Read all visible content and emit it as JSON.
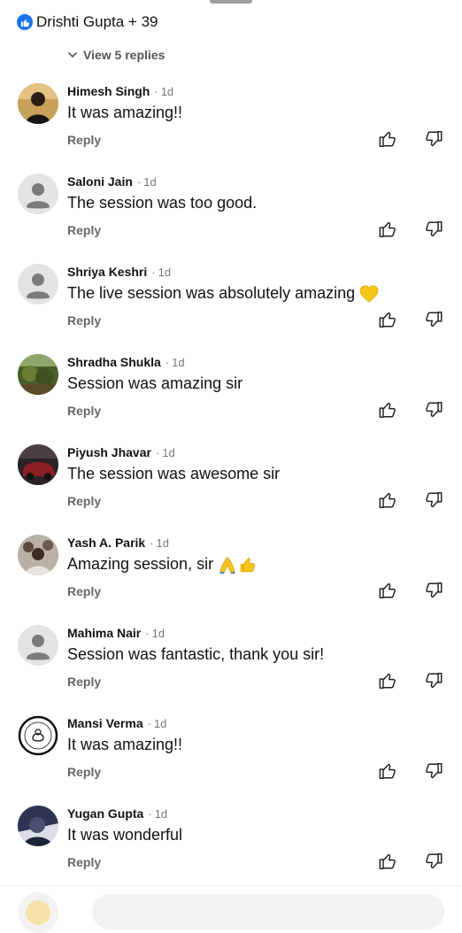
{
  "header": {
    "reactions_text": "Drishti Gupta + 39",
    "view_replies": "View 5 replies"
  },
  "comments": [
    {
      "author": "Himesh Singh",
      "time": "1d",
      "text": "It was amazing!!",
      "reply": "Reply"
    },
    {
      "author": "Saloni Jain",
      "time": "1d",
      "text": "The session was too good.",
      "reply": "Reply"
    },
    {
      "author": "Shriya Keshri",
      "time": "1d",
      "text": "The live session was absolutely amazing",
      "reply": "Reply"
    },
    {
      "author": "Shradha Shukla",
      "time": "1d",
      "text": "Session was amazing sir",
      "reply": "Reply"
    },
    {
      "author": "Piyush Jhavar",
      "time": "1d",
      "text": "The session was awesome sir",
      "reply": "Reply"
    },
    {
      "author": "Yash A. Parik",
      "time": "1d",
      "text": "Amazing session, sir",
      "reply": "Reply"
    },
    {
      "author": "Mahima Nair",
      "time": "1d",
      "text": "Session was fantastic, thank you sir!",
      "reply": "Reply"
    },
    {
      "author": "Mansi Verma",
      "time": "1d",
      "text": "It was amazing!!",
      "reply": "Reply"
    },
    {
      "author": "Yugan Gupta",
      "time": "1d",
      "text": "It was wonderful",
      "reply": "Reply"
    }
  ],
  "separator": "·",
  "icons": {
    "reaction": "like-badge-icon",
    "expand": "chevron-down-icon",
    "like": "thumbs-up-icon",
    "dislike": "thumbs-down-icon",
    "default_avatar": "person-silhouette-icon"
  },
  "colors": {
    "like_badge": "#1a73e8",
    "text": "#111111",
    "muted": "#777777",
    "emoji_heart": "#f5c518"
  }
}
